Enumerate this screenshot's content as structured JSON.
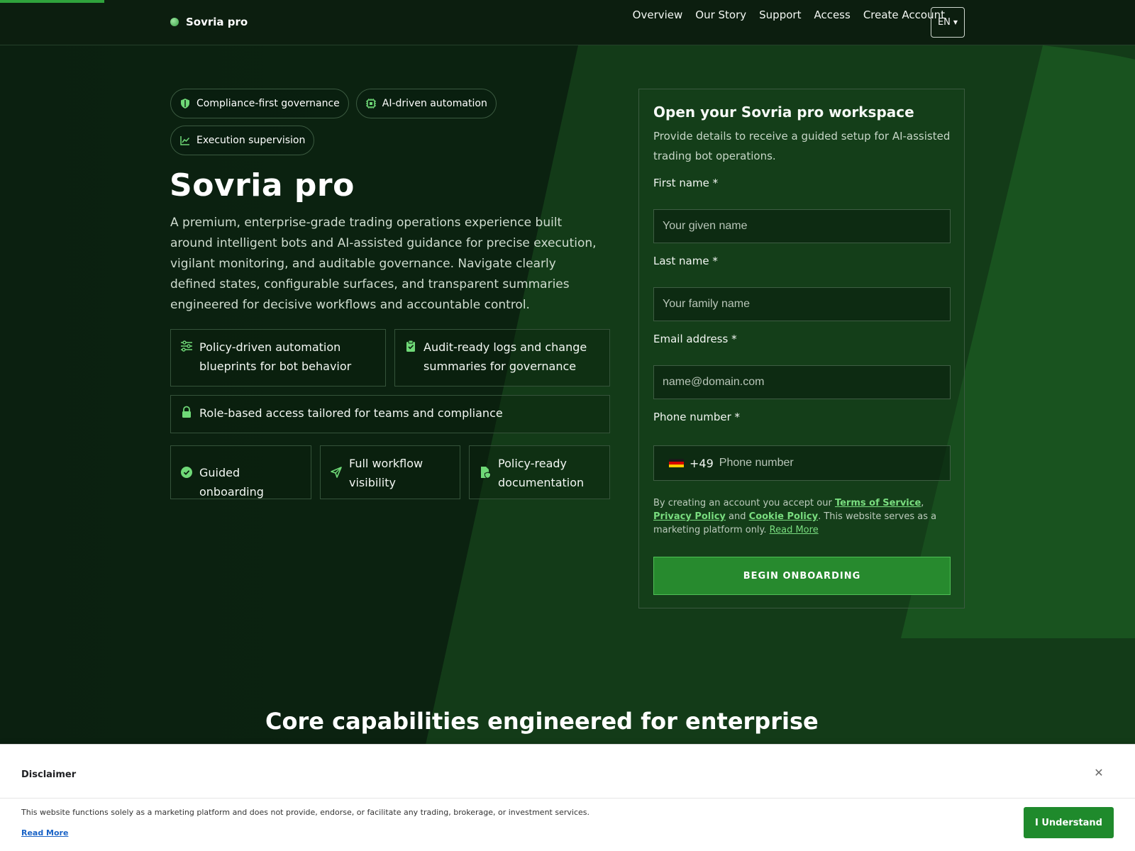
{
  "page": {
    "progress_percent": 9.2
  },
  "header": {
    "brand": "Sovria pro",
    "nav": [
      "Overview",
      "Our Story",
      "Support",
      "Access",
      "Create Account"
    ],
    "language": "EN"
  },
  "hero": {
    "chips": [
      {
        "label": "Compliance-first governance",
        "icon": "shield-icon"
      },
      {
        "label": "AI-driven automation",
        "icon": "chip-icon"
      },
      {
        "label": "Execution supervision",
        "icon": "line-chart-icon"
      }
    ],
    "title": "Sovria pro",
    "description": "A premium, enterprise-grade trading operations experience built around intelligent bots and AI-assisted guidance for precise execution, vigilant monitoring, and auditable governance. Navigate clearly defined states, configurable surfaces, and transparent summaries engineered for decisive workflows and accountable control.",
    "features": [
      {
        "label": "Policy-driven automation blueprints for bot behavior",
        "icon": "sliders-icon"
      },
      {
        "label": "Audit-ready logs and change summaries for governance",
        "icon": "clipboard-check-icon"
      },
      {
        "label": "Role-based access tailored for teams and compliance",
        "icon": "lock-icon"
      }
    ],
    "mini_features": [
      {
        "label": "Guided onboarding",
        "icon": "check-circle-icon"
      },
      {
        "label": "Full workflow visibility",
        "icon": "send-icon"
      },
      {
        "label": "Policy-ready documentation",
        "icon": "file-shield-icon"
      }
    ]
  },
  "form": {
    "title": "Open your Sovria pro workspace",
    "subtitle": "Provide details to receive a guided setup for AI-assisted trading bot operations.",
    "first_name_label": "First name *",
    "first_name_placeholder": "Your given name",
    "last_name_label": "Last name *",
    "last_name_placeholder": "Your family name",
    "email_label": "Email address *",
    "email_placeholder": "name@domain.com",
    "phone_label": "Phone number *",
    "phone_code": "+49",
    "phone_placeholder": "Phone number",
    "legal_prefix": "By creating an account you accept our",
    "terms": "Terms of Service",
    "privacy": "Privacy Policy",
    "legal_and": "and",
    "cookie": "Cookie Policy",
    "legal_suffix": ". This website serves as a marketing platform only.",
    "read_more": "Read More",
    "submit": "BEGIN ONBOARDING"
  },
  "section": {
    "title": "Core capabilities engineered for enterprise"
  },
  "disclaimer": {
    "title": "Disclaimer",
    "text": "This website functions solely as a marketing platform and does not provide, endorse, or facilitate any trading, brokerage, or investment services.",
    "read_more": "Read More",
    "button": "I Understand"
  },
  "colors": {
    "accent": "#2fa33c",
    "link": "#79dd7f",
    "button": "#278a2e",
    "background": "#0b2010"
  }
}
